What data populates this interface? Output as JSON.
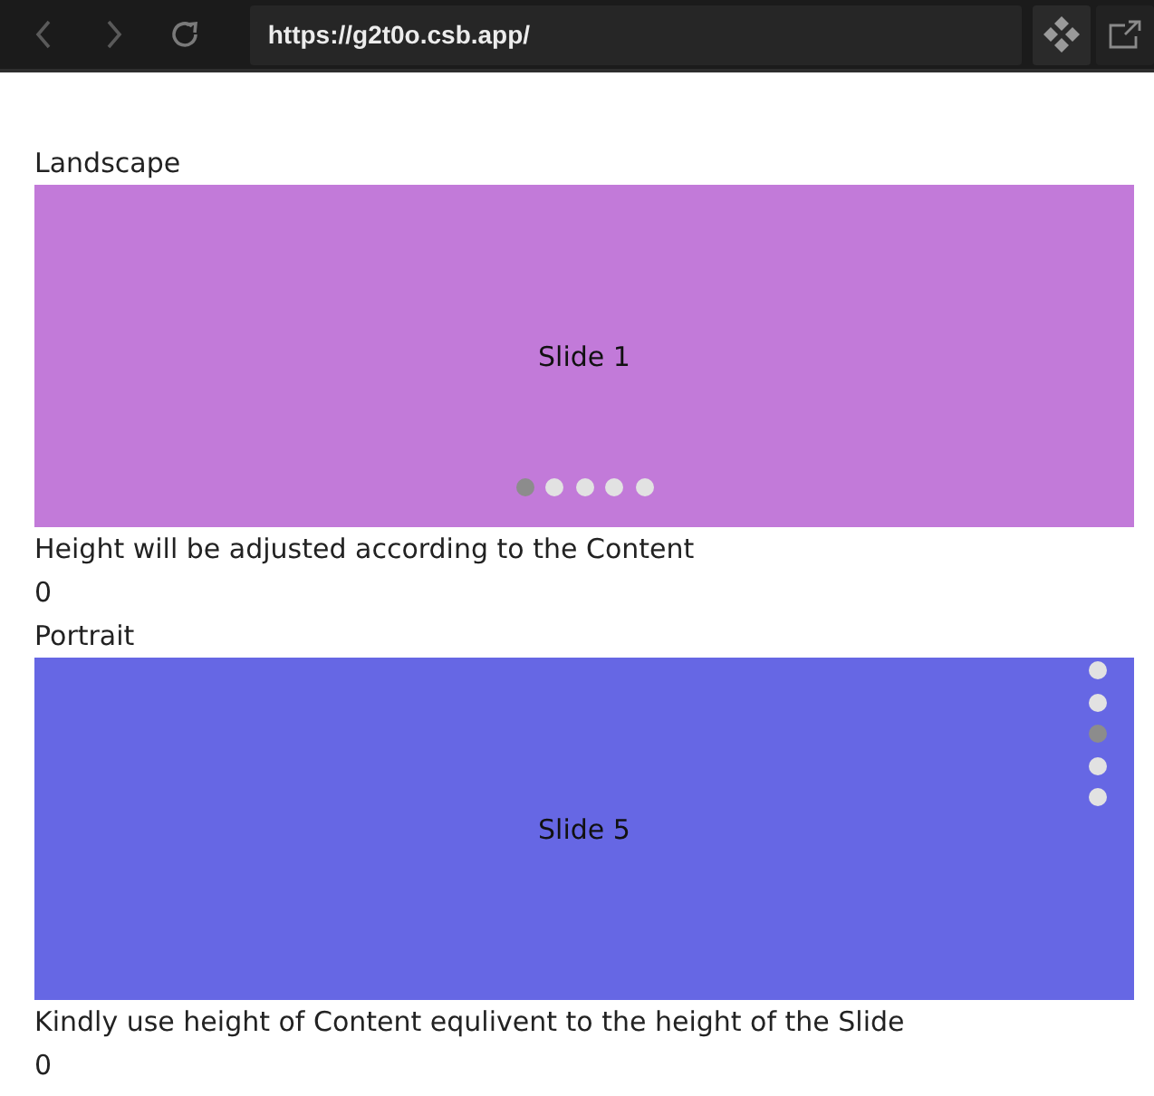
{
  "browser": {
    "url": "https://g2t0o.csb.app/"
  },
  "sections": [
    {
      "heading": "Landscape",
      "kind": "horizontal",
      "color": "#c27ad9",
      "slide_label": "Slide 1",
      "dots": [
        {
          "selected": true
        },
        {
          "selected": false
        },
        {
          "selected": false
        },
        {
          "selected": false
        },
        {
          "selected": false
        }
      ],
      "note": "Height will be adjusted according to the Content",
      "counter": "0"
    },
    {
      "heading": "Portrait",
      "kind": "vertical",
      "color": "#6667e4",
      "slide_label": "Slide 5",
      "dots": [
        {
          "selected": false
        },
        {
          "selected": false
        },
        {
          "selected": true
        },
        {
          "selected": false
        },
        {
          "selected": false
        }
      ],
      "note": "Kindly use height of Content equlivent to the height of the Slide",
      "counter": "0"
    }
  ]
}
